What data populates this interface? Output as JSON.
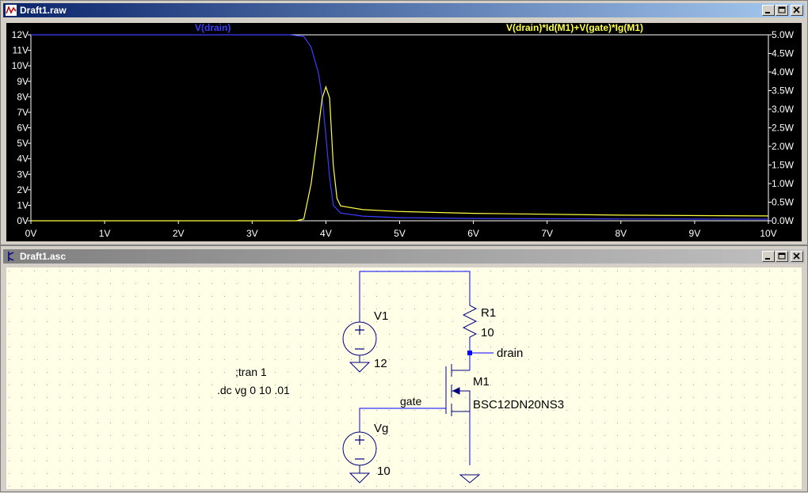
{
  "waveform_window": {
    "title": "Draft1.raw",
    "trace_left_label": "V(drain)",
    "trace_right_label": "V(drain)*Id(M1)+V(gate)*Ig(M1)",
    "left_axis_ticks": [
      "12V",
      "11V",
      "10V",
      "9V",
      "8V",
      "7V",
      "6V",
      "5V",
      "4V",
      "3V",
      "2V",
      "1V",
      "0V"
    ],
    "right_axis_ticks": [
      "5.0W",
      "4.5W",
      "4.0W",
      "3.5W",
      "3.0W",
      "2.5W",
      "2.0W",
      "1.5W",
      "1.0W",
      "0.5W",
      "0.0W"
    ],
    "x_axis_ticks": [
      "0V",
      "1V",
      "2V",
      "3V",
      "4V",
      "5V",
      "6V",
      "7V",
      "8V",
      "9V",
      "10V"
    ],
    "colors": {
      "vdrain": "#3c3cff",
      "power": "#ffff40",
      "grid": "#808080",
      "text": "#ffffff"
    }
  },
  "chart_data": {
    "type": "line",
    "xlabel": "",
    "xlim": [
      0,
      10
    ],
    "series": [
      {
        "name": "V(drain)",
        "axis": "left",
        "ylim": [
          0,
          12
        ],
        "x": [
          0,
          3.5,
          3.7,
          3.8,
          3.9,
          3.95,
          4.0,
          4.05,
          4.1,
          4.2,
          4.5,
          5,
          6,
          8,
          10
        ],
        "y": [
          12,
          12,
          11.9,
          11.2,
          9.5,
          8.0,
          5.5,
          2.8,
          1.0,
          0.5,
          0.3,
          0.2,
          0.15,
          0.12,
          0.1
        ]
      },
      {
        "name": "V(drain)*Id(M1)+V(gate)*Ig(M1)",
        "axis": "right",
        "ylim": [
          0,
          5
        ],
        "x": [
          0,
          3.6,
          3.7,
          3.8,
          3.9,
          3.95,
          4.0,
          4.05,
          4.1,
          4.15,
          4.2,
          4.5,
          5,
          6,
          8,
          10
        ],
        "y": [
          0,
          0,
          0.05,
          1.0,
          2.5,
          3.3,
          3.6,
          3.3,
          1.5,
          0.6,
          0.4,
          0.3,
          0.25,
          0.2,
          0.15,
          0.13
        ]
      }
    ]
  },
  "schematic_window": {
    "title": "Draft1.asc",
    "labels": {
      "v1_name": "V1",
      "v1_value": "12",
      "r1_name": "R1",
      "r1_value": "10",
      "drain_net": "drain",
      "gate_net": "gate",
      "m1_name": "M1",
      "m1_model": "BSC12DN20NS3",
      "vg_name": "Vg",
      "vg_value": "10",
      "directive_tran": ";tran 1",
      "directive_dc": ".dc vg 0 10 .01"
    },
    "colors": {
      "wire": "#0000ff",
      "component": "#000080",
      "text": "#000000",
      "background": "#ffffe8",
      "dot": "#a0a0a0"
    }
  }
}
